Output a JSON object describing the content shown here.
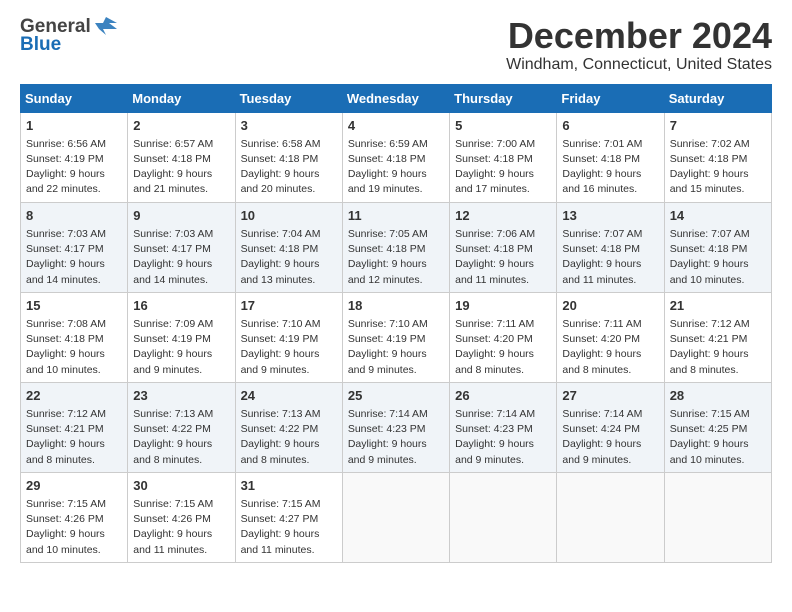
{
  "header": {
    "logo_general": "General",
    "logo_blue": "Blue",
    "month_title": "December 2024",
    "location": "Windham, Connecticut, United States"
  },
  "days_of_week": [
    "Sunday",
    "Monday",
    "Tuesday",
    "Wednesday",
    "Thursday",
    "Friday",
    "Saturday"
  ],
  "weeks": [
    [
      {
        "day": "1",
        "sunrise": "6:56 AM",
        "sunset": "4:19 PM",
        "daylight": "9 hours and 22 minutes."
      },
      {
        "day": "2",
        "sunrise": "6:57 AM",
        "sunset": "4:18 PM",
        "daylight": "9 hours and 21 minutes."
      },
      {
        "day": "3",
        "sunrise": "6:58 AM",
        "sunset": "4:18 PM",
        "daylight": "9 hours and 20 minutes."
      },
      {
        "day": "4",
        "sunrise": "6:59 AM",
        "sunset": "4:18 PM",
        "daylight": "9 hours and 19 minutes."
      },
      {
        "day": "5",
        "sunrise": "7:00 AM",
        "sunset": "4:18 PM",
        "daylight": "9 hours and 17 minutes."
      },
      {
        "day": "6",
        "sunrise": "7:01 AM",
        "sunset": "4:18 PM",
        "daylight": "9 hours and 16 minutes."
      },
      {
        "day": "7",
        "sunrise": "7:02 AM",
        "sunset": "4:18 PM",
        "daylight": "9 hours and 15 minutes."
      }
    ],
    [
      {
        "day": "8",
        "sunrise": "7:03 AM",
        "sunset": "4:17 PM",
        "daylight": "9 hours and 14 minutes."
      },
      {
        "day": "9",
        "sunrise": "7:03 AM",
        "sunset": "4:17 PM",
        "daylight": "9 hours and 14 minutes."
      },
      {
        "day": "10",
        "sunrise": "7:04 AM",
        "sunset": "4:18 PM",
        "daylight": "9 hours and 13 minutes."
      },
      {
        "day": "11",
        "sunrise": "7:05 AM",
        "sunset": "4:18 PM",
        "daylight": "9 hours and 12 minutes."
      },
      {
        "day": "12",
        "sunrise": "7:06 AM",
        "sunset": "4:18 PM",
        "daylight": "9 hours and 11 minutes."
      },
      {
        "day": "13",
        "sunrise": "7:07 AM",
        "sunset": "4:18 PM",
        "daylight": "9 hours and 11 minutes."
      },
      {
        "day": "14",
        "sunrise": "7:07 AM",
        "sunset": "4:18 PM",
        "daylight": "9 hours and 10 minutes."
      }
    ],
    [
      {
        "day": "15",
        "sunrise": "7:08 AM",
        "sunset": "4:18 PM",
        "daylight": "9 hours and 10 minutes."
      },
      {
        "day": "16",
        "sunrise": "7:09 AM",
        "sunset": "4:19 PM",
        "daylight": "9 hours and 9 minutes."
      },
      {
        "day": "17",
        "sunrise": "7:10 AM",
        "sunset": "4:19 PM",
        "daylight": "9 hours and 9 minutes."
      },
      {
        "day": "18",
        "sunrise": "7:10 AM",
        "sunset": "4:19 PM",
        "daylight": "9 hours and 9 minutes."
      },
      {
        "day": "19",
        "sunrise": "7:11 AM",
        "sunset": "4:20 PM",
        "daylight": "9 hours and 8 minutes."
      },
      {
        "day": "20",
        "sunrise": "7:11 AM",
        "sunset": "4:20 PM",
        "daylight": "9 hours and 8 minutes."
      },
      {
        "day": "21",
        "sunrise": "7:12 AM",
        "sunset": "4:21 PM",
        "daylight": "9 hours and 8 minutes."
      }
    ],
    [
      {
        "day": "22",
        "sunrise": "7:12 AM",
        "sunset": "4:21 PM",
        "daylight": "9 hours and 8 minutes."
      },
      {
        "day": "23",
        "sunrise": "7:13 AM",
        "sunset": "4:22 PM",
        "daylight": "9 hours and 8 minutes."
      },
      {
        "day": "24",
        "sunrise": "7:13 AM",
        "sunset": "4:22 PM",
        "daylight": "9 hours and 8 minutes."
      },
      {
        "day": "25",
        "sunrise": "7:14 AM",
        "sunset": "4:23 PM",
        "daylight": "9 hours and 9 minutes."
      },
      {
        "day": "26",
        "sunrise": "7:14 AM",
        "sunset": "4:23 PM",
        "daylight": "9 hours and 9 minutes."
      },
      {
        "day": "27",
        "sunrise": "7:14 AM",
        "sunset": "4:24 PM",
        "daylight": "9 hours and 9 minutes."
      },
      {
        "day": "28",
        "sunrise": "7:15 AM",
        "sunset": "4:25 PM",
        "daylight": "9 hours and 10 minutes."
      }
    ],
    [
      {
        "day": "29",
        "sunrise": "7:15 AM",
        "sunset": "4:26 PM",
        "daylight": "9 hours and 10 minutes."
      },
      {
        "day": "30",
        "sunrise": "7:15 AM",
        "sunset": "4:26 PM",
        "daylight": "9 hours and 11 minutes."
      },
      {
        "day": "31",
        "sunrise": "7:15 AM",
        "sunset": "4:27 PM",
        "daylight": "9 hours and 11 minutes."
      },
      null,
      null,
      null,
      null
    ]
  ],
  "labels": {
    "sunrise": "Sunrise:",
    "sunset": "Sunset:",
    "daylight": "Daylight:"
  }
}
